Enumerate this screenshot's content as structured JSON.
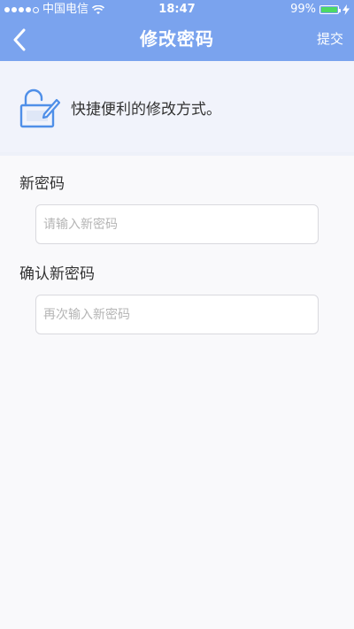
{
  "status_bar": {
    "carrier": "中国电信",
    "time": "18:47",
    "battery": "99%",
    "signal_bars": 4
  },
  "nav": {
    "title": "修改密码",
    "submit_label": "提交"
  },
  "banner": {
    "message": "快捷便利的修改方式。"
  },
  "form": {
    "new_password": {
      "label": "新密码",
      "placeholder": "请输入新密码",
      "value": ""
    },
    "confirm_password": {
      "label": "确认新密码",
      "placeholder": "再次输入新密码",
      "value": ""
    }
  },
  "colors": {
    "header": "#7aa3ee",
    "accent": "#4f8fe8",
    "battery": "#4cd964",
    "page_bg": "#f9f9fb"
  }
}
